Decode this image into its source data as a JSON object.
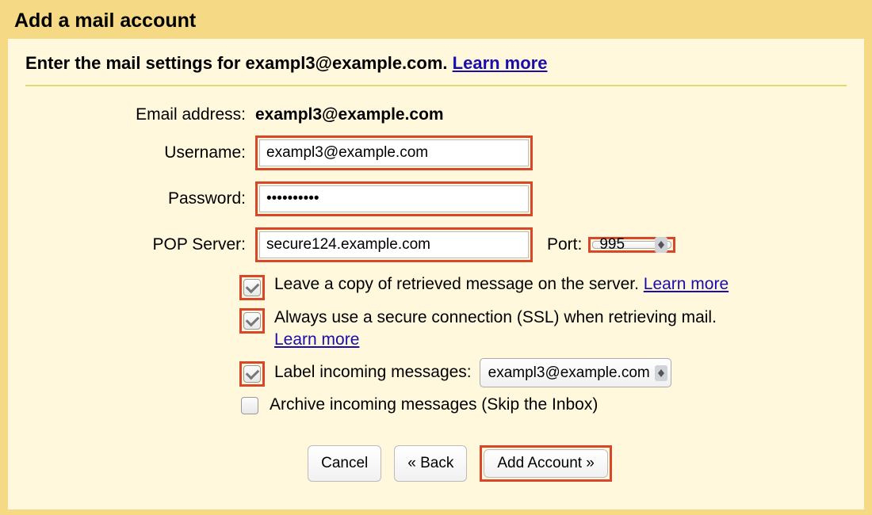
{
  "header": {
    "title": "Add a mail account"
  },
  "instruction": {
    "prefix": "Enter the mail settings for ",
    "email": "exampl3@example.com",
    "suffix": ". ",
    "learn_more": "Learn more"
  },
  "form": {
    "email_label": "Email address:",
    "email_value": "exampl3@example.com",
    "username_label": "Username:",
    "username_value": "exampl3@example.com",
    "password_label": "Password:",
    "password_value": "••••••••••",
    "pop_label": "POP Server:",
    "pop_value": "secure124.example.com",
    "port_label": "Port:",
    "port_value": "995"
  },
  "options": {
    "leave_copy": {
      "checked": true,
      "text": "Leave a copy of retrieved message on the server. ",
      "learn_more": "Learn more"
    },
    "ssl": {
      "checked": true,
      "text": "Always use a secure connection (SSL) when retrieving mail. ",
      "learn_more": "Learn more"
    },
    "label_incoming": {
      "checked": true,
      "text": "Label incoming messages:",
      "select_value": "exampl3@example.com"
    },
    "archive": {
      "checked": false,
      "text": "Archive incoming messages (Skip the Inbox)"
    }
  },
  "buttons": {
    "cancel": "Cancel",
    "back": "« Back",
    "add": "Add Account »"
  }
}
